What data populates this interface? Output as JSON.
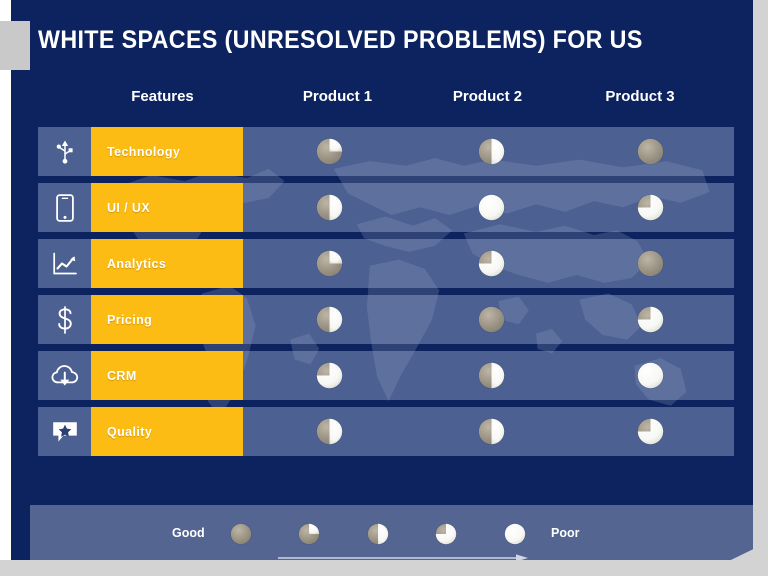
{
  "slide": {
    "title": "WHITE SPACES (UNRESOLVED PROBLEMS) FOR US",
    "background_color": "#0d2360",
    "accent_color": "#fcbc13",
    "row_color": "#96a8cd",
    "legend_band_color": "#546591",
    "page_background": "#d3d3d3"
  },
  "table": {
    "headers": {
      "features": "Features",
      "product_1": "Product 1",
      "product_2": "Product 2",
      "product_3": "Product 3"
    },
    "rows": [
      {
        "icon": "usb-icon",
        "label": "Technology",
        "product_1": 25,
        "product_2": 50,
        "product_3": 0
      },
      {
        "icon": "smartphone-icon",
        "label": "UI / UX",
        "product_1": 50,
        "product_2": 100,
        "product_3": 75
      },
      {
        "icon": "line-chart-icon",
        "label": "Analytics",
        "product_1": 25,
        "product_2": 75,
        "product_3": 0
      },
      {
        "icon": "dollar-sign-icon",
        "label": "Pricing",
        "product_1": 50,
        "product_2": 0,
        "product_3": 75
      },
      {
        "icon": "cloud-download-icon",
        "label": "CRM",
        "product_1": 75,
        "product_2": 50,
        "product_3": 100
      },
      {
        "icon": "speech-star-icon",
        "label": "Quality",
        "product_1": 50,
        "product_2": 50,
        "product_3": 75
      }
    ]
  },
  "legend": {
    "good_label": "Good",
    "poor_label": "Poor",
    "scale": [
      0,
      25,
      50,
      75,
      100
    ],
    "arrow": "right-arrow-icon"
  }
}
